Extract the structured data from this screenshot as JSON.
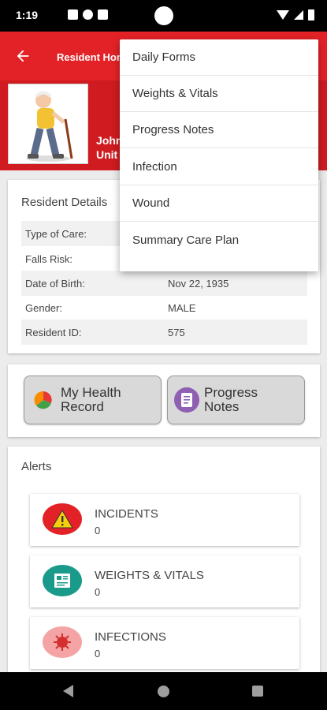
{
  "status_bar": {
    "time": "1:19"
  },
  "header": {
    "title": "Resident Home"
  },
  "resident": {
    "name": "John",
    "unit": "Unit"
  },
  "details": {
    "title": "Resident Details",
    "rows": [
      {
        "label": "Type of Care:",
        "value": ""
      },
      {
        "label": "Falls Risk:",
        "value": ""
      },
      {
        "label": "Date of Birth:",
        "value": "Nov 22, 1935"
      },
      {
        "label": "Gender:",
        "value": "MALE"
      },
      {
        "label": "Resident ID:",
        "value": "575"
      }
    ]
  },
  "actions": {
    "health_record_label": "My Health Record",
    "progress_notes_label": "Progress Notes"
  },
  "alerts": {
    "title": "Alerts",
    "items": [
      {
        "label": "INCIDENTS",
        "count": "0",
        "icon": "warning-icon",
        "color": "#e32227"
      },
      {
        "label": "WEIGHTS & VITALS",
        "count": "0",
        "icon": "vitals-icon",
        "color": "#1a9a8a"
      },
      {
        "label": "INFECTIONS",
        "count": "0",
        "icon": "germ-icon",
        "color": "#f4a4a4"
      }
    ]
  },
  "menu": {
    "items": [
      "Daily Forms",
      "Weights & Vitals",
      "Progress Notes",
      "Infection",
      "Wound",
      "Summary Care Plan"
    ]
  },
  "colors": {
    "brand_red": "#e32227",
    "dark_red": "#d01b20"
  }
}
